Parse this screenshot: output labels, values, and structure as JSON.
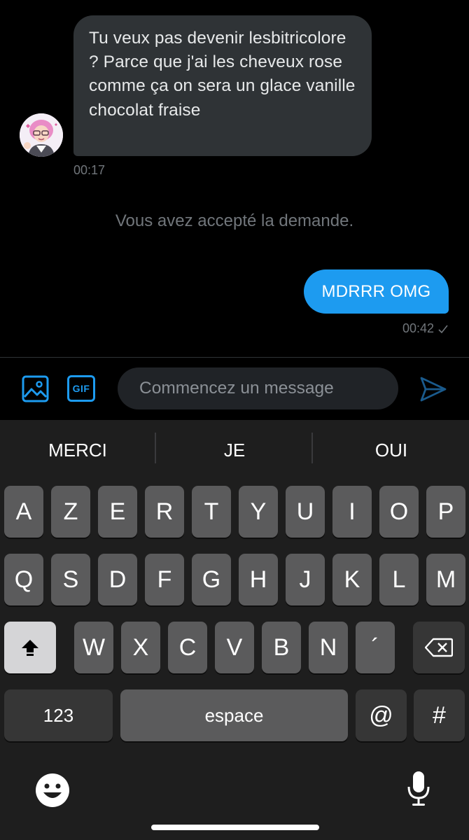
{
  "conversation": {
    "incoming": {
      "text": "Tu veux pas devenir lesbitricolore ? Parce que j'ai les cheveux rose comme ça on sera un glace vanille chocolat fraise",
      "time": "00:17"
    },
    "system_notice": "Vous avez accepté la demande.",
    "outgoing": {
      "text": "MDRRR OMG",
      "time": "00:42",
      "status_icon": "checkmark-icon"
    }
  },
  "composer": {
    "image_button_icon": "image-icon",
    "gif_label": "GIF",
    "placeholder": "Commencez un message",
    "send_icon": "send-icon"
  },
  "keyboard": {
    "suggestions": [
      "MERCI",
      "JE",
      "OUI"
    ],
    "row1": [
      "A",
      "Z",
      "E",
      "R",
      "T",
      "Y",
      "U",
      "I",
      "O",
      "P"
    ],
    "row2": [
      "Q",
      "S",
      "D",
      "F",
      "G",
      "H",
      "J",
      "K",
      "L",
      "M"
    ],
    "row3": [
      "W",
      "X",
      "C",
      "V",
      "B",
      "N",
      "´"
    ],
    "numbers_label": "123",
    "space_label": "espace",
    "at_label": "@",
    "hash_label": "#",
    "shift_icon": "shift-icon",
    "delete_icon": "backspace-icon",
    "emoji_icon": "emoji-icon",
    "mic_icon": "microphone-icon"
  },
  "colors": {
    "accent": "#1d9bf0",
    "incoming_bubble": "#2f3336",
    "muted_text": "#71767b"
  }
}
